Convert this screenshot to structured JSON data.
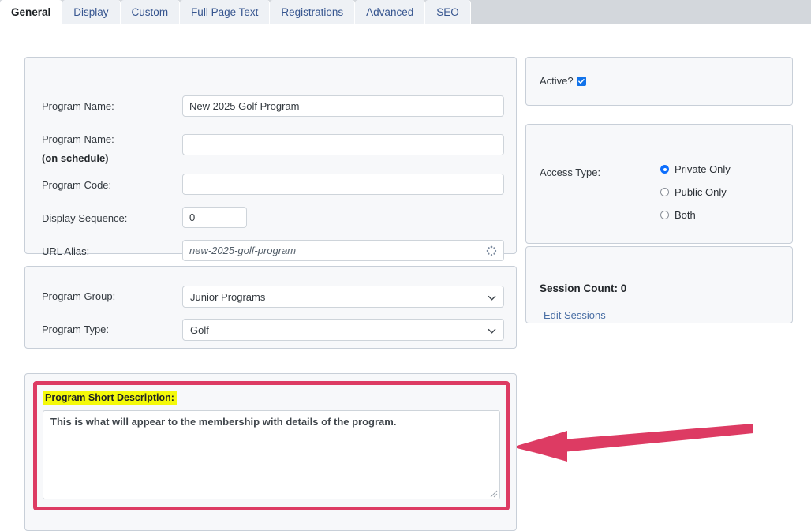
{
  "tabs": [
    {
      "label": "General",
      "active": true
    },
    {
      "label": "Display",
      "active": false
    },
    {
      "label": "Custom",
      "active": false
    },
    {
      "label": "Full Page Text",
      "active": false
    },
    {
      "label": "Registrations",
      "active": false
    },
    {
      "label": "Advanced",
      "active": false
    },
    {
      "label": "SEO",
      "active": false
    }
  ],
  "identity_panel": {
    "program_name": {
      "label": "Program Name:",
      "value": "New 2025 Golf Program",
      "placeholder": ""
    },
    "program_name_schedule": {
      "label": "Program Name:",
      "label2": "(on schedule)",
      "value": "",
      "placeholder": ""
    },
    "program_code": {
      "label": "Program Code:",
      "value": "",
      "placeholder": ""
    },
    "display_sequence": {
      "label": "Display Sequence:",
      "value": "0",
      "placeholder": ""
    },
    "url_alias": {
      "label": "URL Alias:",
      "value": "new-2025-golf-program",
      "placeholder": "new-2025-golf-program",
      "icon": "spinner-icon"
    }
  },
  "classification_panel": {
    "program_group": {
      "label": "Program Group:",
      "value": "Junior Programs",
      "options": [
        "Junior Programs"
      ]
    },
    "program_type": {
      "label": "Program Type:",
      "value": "Golf",
      "options": [
        "Golf"
      ]
    }
  },
  "description_panel": {
    "label": "Program Short Description:",
    "value": "This is what will appear to the membership with details of the program.",
    "placeholder": ""
  },
  "active_panel": {
    "label": "Active?",
    "checked": true
  },
  "access_panel": {
    "label": "Access Type:",
    "options": [
      {
        "label": "Private Only",
        "selected": true
      },
      {
        "label": "Public Only",
        "selected": false
      },
      {
        "label": "Both",
        "selected": false
      }
    ]
  },
  "session_panel": {
    "count_label": "Session Count: 0",
    "edit_link": "Edit Sessions"
  },
  "annotation": {
    "highlight_color": "#f4f90a",
    "accent_color": "#dd3b63",
    "arrow_direction": "left"
  }
}
